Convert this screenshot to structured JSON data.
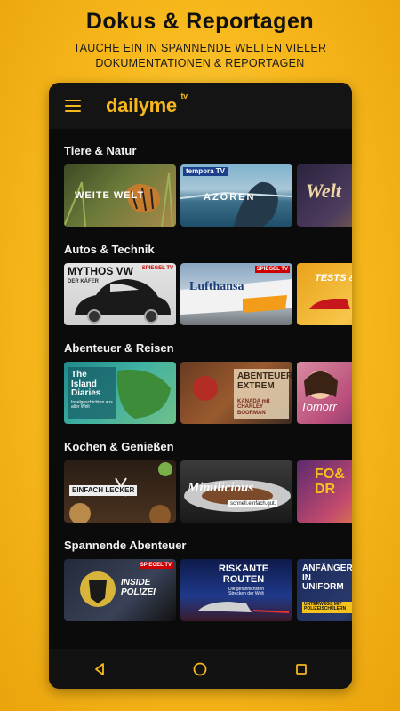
{
  "promo": {
    "title": "Dokus & Reportagen",
    "subtitle": "TAUCHE EIN IN SPANNENDE WELTEN VIELER DOKUMENTATIONEN & REPORTAGEN"
  },
  "app": {
    "logo": "dailyme",
    "logo_sup": "tv",
    "accent": "#f5b71c",
    "menu_icon": "hamburger-menu-icon"
  },
  "categories": [
    {
      "title": "Tiere & Natur",
      "items": [
        {
          "label": "WEITE WELT"
        },
        {
          "label": "AZOREN",
          "badge": "tempora TV"
        },
        {
          "label": "Welt"
        }
      ]
    },
    {
      "title": "Autos & Technik",
      "items": [
        {
          "label": "MYTHOS VW",
          "sub": "DER KÄFER",
          "badge": "SPIEGEL TV"
        },
        {
          "label": "Lufthansa",
          "badge": "SPIEGEL TV"
        },
        {
          "label": "TESTS & AC"
        }
      ]
    },
    {
      "title": "Abenteuer & Reisen",
      "items": [
        {
          "label": "The Island Diaries",
          "sub": "Inselgeschichten aus aller Welt"
        },
        {
          "label": "ABENTEUER EXTREM",
          "sub": "KANADA mit CHARLEY BOORMAN"
        },
        {
          "label": "Tomorr"
        }
      ]
    },
    {
      "title": "Kochen & Genießen",
      "items": [
        {
          "label": "EINFACH LECKER"
        },
        {
          "label": "Mimilicious",
          "sub": "schnell.einfach.gut."
        },
        {
          "label": "FO& DR"
        }
      ]
    },
    {
      "title": "Spannende Abenteuer",
      "items": [
        {
          "label": "INSIDE POLIZEI",
          "badge": "SPIEGEL TV"
        },
        {
          "label": "RISKANTE ROUTEN",
          "sub": "Die gefährlichsten Strecken der Welt"
        },
        {
          "label": "ANFÄNGER IN UNIFORM",
          "sub": "UNTERWEGS MIT POLIZEISCHÜLERN"
        }
      ]
    }
  ],
  "nav": {
    "back_icon": "back-triangle-icon",
    "home_icon": "home-circle-icon",
    "recents_icon": "recents-square-icon"
  }
}
